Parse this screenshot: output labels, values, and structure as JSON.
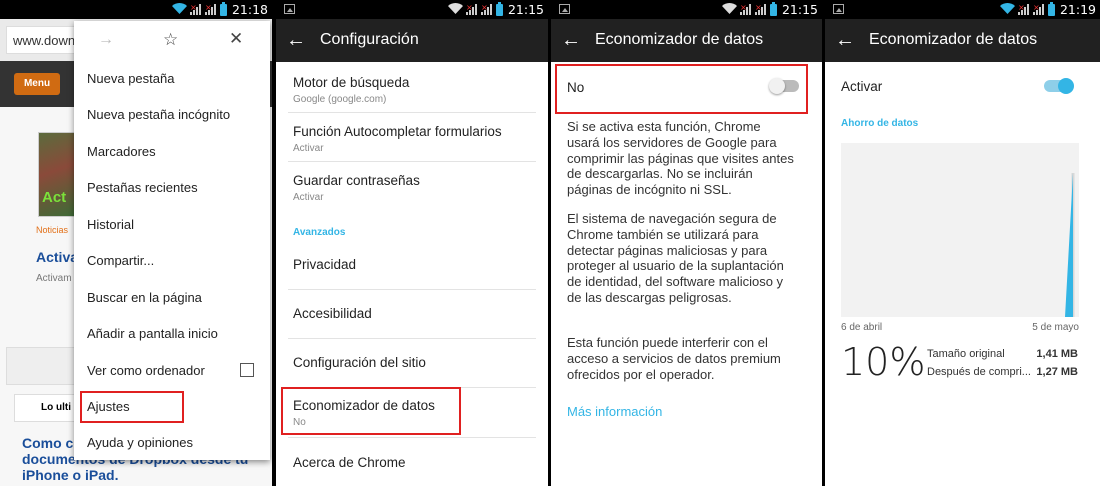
{
  "statusbar": {
    "p1_time": "21:18",
    "p2_time": "21:15",
    "p3_time": "21:15",
    "p4_time": "21:19"
  },
  "panel1": {
    "url": "www.down",
    "site_menu": "Menu",
    "thumb_text": "Act",
    "category": "Noticias",
    "headline": "Activa",
    "subline": "Activam",
    "tab_label": "Lo ulti",
    "article_title": "Como co... documentos de Dropbox desde tu iPhone o iPad.",
    "article_line1": "Como co",
    "article_line2": "documentos de Dropbox desde tu",
    "article_line3": "iPhone o iPad.",
    "menu_items": [
      "Nueva pestaña",
      "Nueva pestaña incógnito",
      "Marcadores",
      "Pestañas recientes",
      "Historial",
      "Compartir...",
      "Buscar en la página",
      "Añadir a pantalla inicio",
      "Ver como ordenador",
      "Ajustes",
      "Ayuda y opiniones"
    ]
  },
  "panel2": {
    "title": "Configuración",
    "items": [
      {
        "title": "Motor de búsqueda",
        "sub": "Google (google.com)"
      },
      {
        "title": "Función Autocompletar formularios",
        "sub": "Activar"
      },
      {
        "title": "Guardar contraseñas",
        "sub": "Activar"
      }
    ],
    "section": "Avanzados",
    "advanced": [
      {
        "title": "Privacidad"
      },
      {
        "title": "Accesibilidad"
      },
      {
        "title": "Configuración del sitio"
      },
      {
        "title": "Economizador de datos",
        "sub": "No"
      },
      {
        "title": "Acerca de Chrome"
      }
    ]
  },
  "panel3": {
    "title": "Economizador de datos",
    "toggle_label": "No",
    "toggle_on": false,
    "para1": "Si se activa esta función, Chrome usará los servidores de Google para comprimir las páginas que visites antes de descargarlas. No se incluirán páginas de incógnito ni SSL.",
    "para2": "El sistema de navegación segura de Chrome también se utilizará para detectar páginas maliciosas y para proteger al usuario de la suplantación de identidad, del software malicioso y de las descargas peligrosas.",
    "para3": "Esta función puede interferir con el acceso a servicios de datos premium ofrecidos por el operador.",
    "link": "Más información"
  },
  "panel4": {
    "title": "Economizador de datos",
    "toggle_label": "Activar",
    "toggle_on": true,
    "section": "Ahorro de datos",
    "percent": "10%",
    "orig_label": "Tamaño original",
    "orig_value": "1,41 MB",
    "after_label": "Después de compri...",
    "after_value": "1,27 MB"
  },
  "colors": {
    "accent": "#33b5e5",
    "highlight": "#e02020",
    "site_orange": "#d06b12",
    "actionbar": "#212121"
  },
  "chart_data": {
    "type": "area",
    "title": "",
    "x": [
      "6 de abril",
      "5 de mayo"
    ],
    "series": [
      {
        "values": [
          0,
          0,
          0,
          0,
          0,
          0,
          0,
          0,
          0,
          0,
          0,
          0,
          0,
          0,
          0,
          0,
          0,
          0,
          0,
          0,
          0,
          0,
          0,
          0,
          0,
          0,
          0,
          0,
          0,
          1
        ]
      }
    ],
    "xlabel": "",
    "ylabel": "",
    "grid": false
  }
}
